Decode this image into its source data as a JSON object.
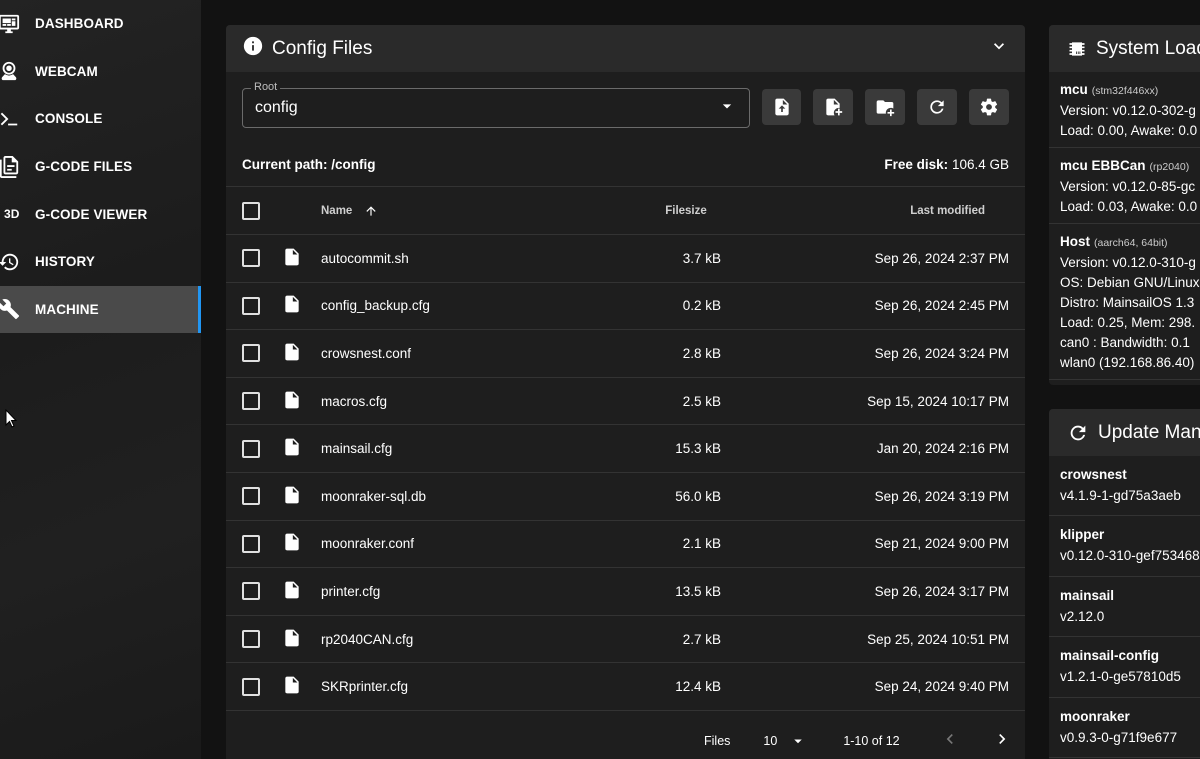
{
  "sidebar": {
    "items": [
      {
        "label": "DASHBOARD",
        "icon": "monitor-dashboard-icon",
        "active": false
      },
      {
        "label": "WEBCAM",
        "icon": "webcam-icon",
        "active": false
      },
      {
        "label": "CONSOLE",
        "icon": "console-icon",
        "active": false
      },
      {
        "label": "G-CODE FILES",
        "icon": "file-document-multiple-icon",
        "active": false
      },
      {
        "label": "G-CODE VIEWER",
        "icon": "3d-icon",
        "active": false
      },
      {
        "label": "HISTORY",
        "icon": "history-icon",
        "active": false
      },
      {
        "label": "MACHINE",
        "icon": "wrench-icon",
        "active": true
      }
    ],
    "icon_3d_text": "3D"
  },
  "config": {
    "title": "Config Files",
    "root_label": "Root",
    "root_value": "config",
    "current_path_label": "Current path:",
    "current_path": "/config",
    "free_disk_label": "Free disk:",
    "free_disk": "106.4 GB",
    "columns": {
      "name": "Name",
      "filesize": "Filesize",
      "modified": "Last modified"
    },
    "files": [
      {
        "name": "autocommit.sh",
        "size": "3.7 kB",
        "modified": "Sep 26, 2024 2:37 PM"
      },
      {
        "name": "config_backup.cfg",
        "size": "0.2 kB",
        "modified": "Sep 26, 2024 2:45 PM"
      },
      {
        "name": "crowsnest.conf",
        "size": "2.8 kB",
        "modified": "Sep 26, 2024 3:24 PM"
      },
      {
        "name": "macros.cfg",
        "size": "2.5 kB",
        "modified": "Sep 15, 2024 10:17 PM"
      },
      {
        "name": "mainsail.cfg",
        "size": "15.3 kB",
        "modified": "Jan 20, 2024 2:16 PM"
      },
      {
        "name": "moonraker-sql.db",
        "size": "56.0 kB",
        "modified": "Sep 26, 2024 3:19 PM"
      },
      {
        "name": "moonraker.conf",
        "size": "2.1 kB",
        "modified": "Sep 21, 2024 9:00 PM"
      },
      {
        "name": "printer.cfg",
        "size": "13.5 kB",
        "modified": "Sep 26, 2024 3:17 PM"
      },
      {
        "name": "rp2040CAN.cfg",
        "size": "2.7 kB",
        "modified": "Sep 25, 2024 10:51 PM"
      },
      {
        "name": "SKRprinter.cfg",
        "size": "12.4 kB",
        "modified": "Sep 24, 2024 9:40 PM"
      }
    ],
    "footer": {
      "files_label": "Files",
      "per_page": "10",
      "range": "1-10 of 12"
    }
  },
  "system_load": {
    "title": "System Load",
    "blocks": [
      {
        "name": "mcu",
        "chip": "(stm32f446xx)",
        "lines": [
          "Version: v0.12.0-302-g",
          "Load: 0.00, Awake: 0.0"
        ]
      },
      {
        "name": "mcu EBBCan",
        "chip": "(rp2040)",
        "lines": [
          "Version: v0.12.0-85-gc",
          "Load: 0.03, Awake: 0.0"
        ]
      },
      {
        "name": "Host",
        "chip": "(aarch64, 64bit)",
        "lines": [
          "Version: v0.12.0-310-g",
          "OS: Debian GNU/Linux",
          "Distro: MainsailOS 1.3",
          "Load: 0.25, Mem: 298.",
          "can0 : Bandwidth: 0.1",
          "wlan0 (192.168.86.40)"
        ]
      }
    ]
  },
  "update_manager": {
    "title": "Update Man",
    "items": [
      {
        "name": "crowsnest",
        "version": "v4.1.9-1-gd75a3aeb"
      },
      {
        "name": "klipper",
        "version": "v0.12.0-310-gef753468"
      },
      {
        "name": "mainsail",
        "version": "v2.12.0"
      },
      {
        "name": "mainsail-config",
        "version": "v1.2.1-0-ge57810d5"
      },
      {
        "name": "moonraker",
        "version": "v0.9.3-0-g71f9e677"
      }
    ]
  }
}
